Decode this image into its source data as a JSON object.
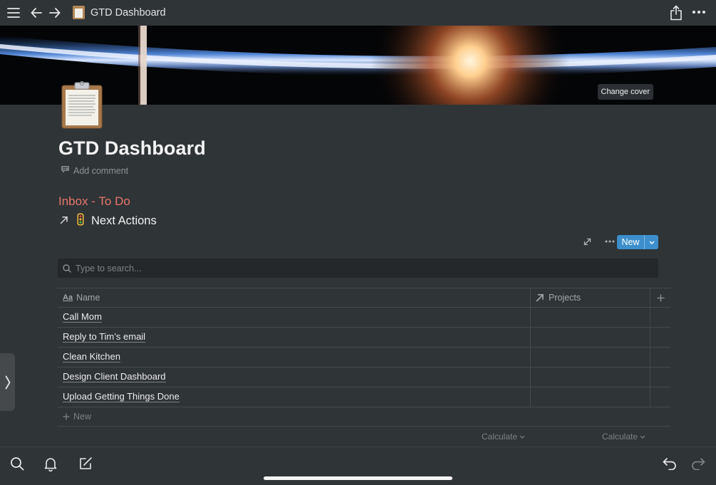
{
  "topbar": {
    "page_title": "GTD Dashboard"
  },
  "cover": {
    "change_cover_label": "Change cover"
  },
  "page": {
    "title": "GTD Dashboard",
    "add_comment_label": "Add comment",
    "inbox_heading": "Inbox - To Do",
    "linked_database_title": "Next Actions",
    "accent_color": "#e8756b"
  },
  "database": {
    "new_button_label": "New",
    "search_placeholder": "Type to search...",
    "columns": [
      {
        "label": "Name",
        "icon": "text-aa-icon"
      },
      {
        "label": "Projects",
        "icon": "relation-arrow-icon"
      }
    ],
    "rows": [
      {
        "name": "Call Mom",
        "projects": ""
      },
      {
        "name": "Reply to Tim’s email",
        "projects": ""
      },
      {
        "name": "Clean Kitchen",
        "projects": ""
      },
      {
        "name": "Design Client Dashboard",
        "projects": ""
      },
      {
        "name": "Upload Getting Things Done",
        "projects": ""
      }
    ],
    "new_row_label": "New",
    "calculate_label": "Calculate"
  },
  "colors": {
    "background": "#2f3437",
    "primary_button": "#3c8fcc"
  }
}
